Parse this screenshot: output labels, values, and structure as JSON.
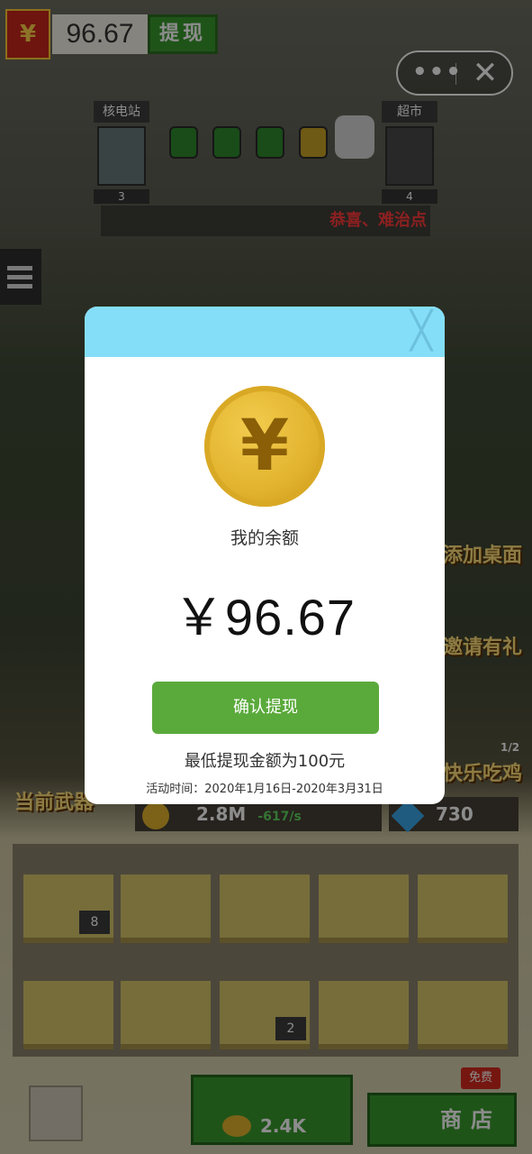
{
  "header": {
    "currency_symbol": "¥",
    "balance": "96.67",
    "withdraw_label": "提现"
  },
  "capsule": {
    "more": "•••",
    "close": "✕"
  },
  "route": {
    "left_station": {
      "label": "核电站",
      "number": "3"
    },
    "right_station": {
      "label": "超市",
      "number": "4"
    },
    "ticker": "恭喜、难治点"
  },
  "side_labels": {
    "add_desktop": "添加桌面",
    "invite": "邀请有礼",
    "happy_chicken": "快乐吃鸡",
    "happy_chicken_count": "1/2",
    "current_weapon": "当前武器"
  },
  "resources": {
    "coins": "2.8M",
    "coins_rate": "-617/s",
    "gems": "730"
  },
  "grid": {
    "slot1_level": "8",
    "slot2_level": "2"
  },
  "bottom": {
    "buy_price": "2.4K",
    "shop_label": "商店",
    "free_badge": "免费"
  },
  "modal": {
    "close": "╳",
    "coin_symbol": "¥",
    "balance_label": "我的余额",
    "balance_value": "￥96.67",
    "confirm_label": "确认提现",
    "min_note": "最低提现金额为100元",
    "period": "活动时间：2020年1月16日-2020年3月31日"
  },
  "colors": {
    "modal_header": "#84def8",
    "confirm_green": "#5aaa3b",
    "coin_gold": "#e1b22d"
  }
}
